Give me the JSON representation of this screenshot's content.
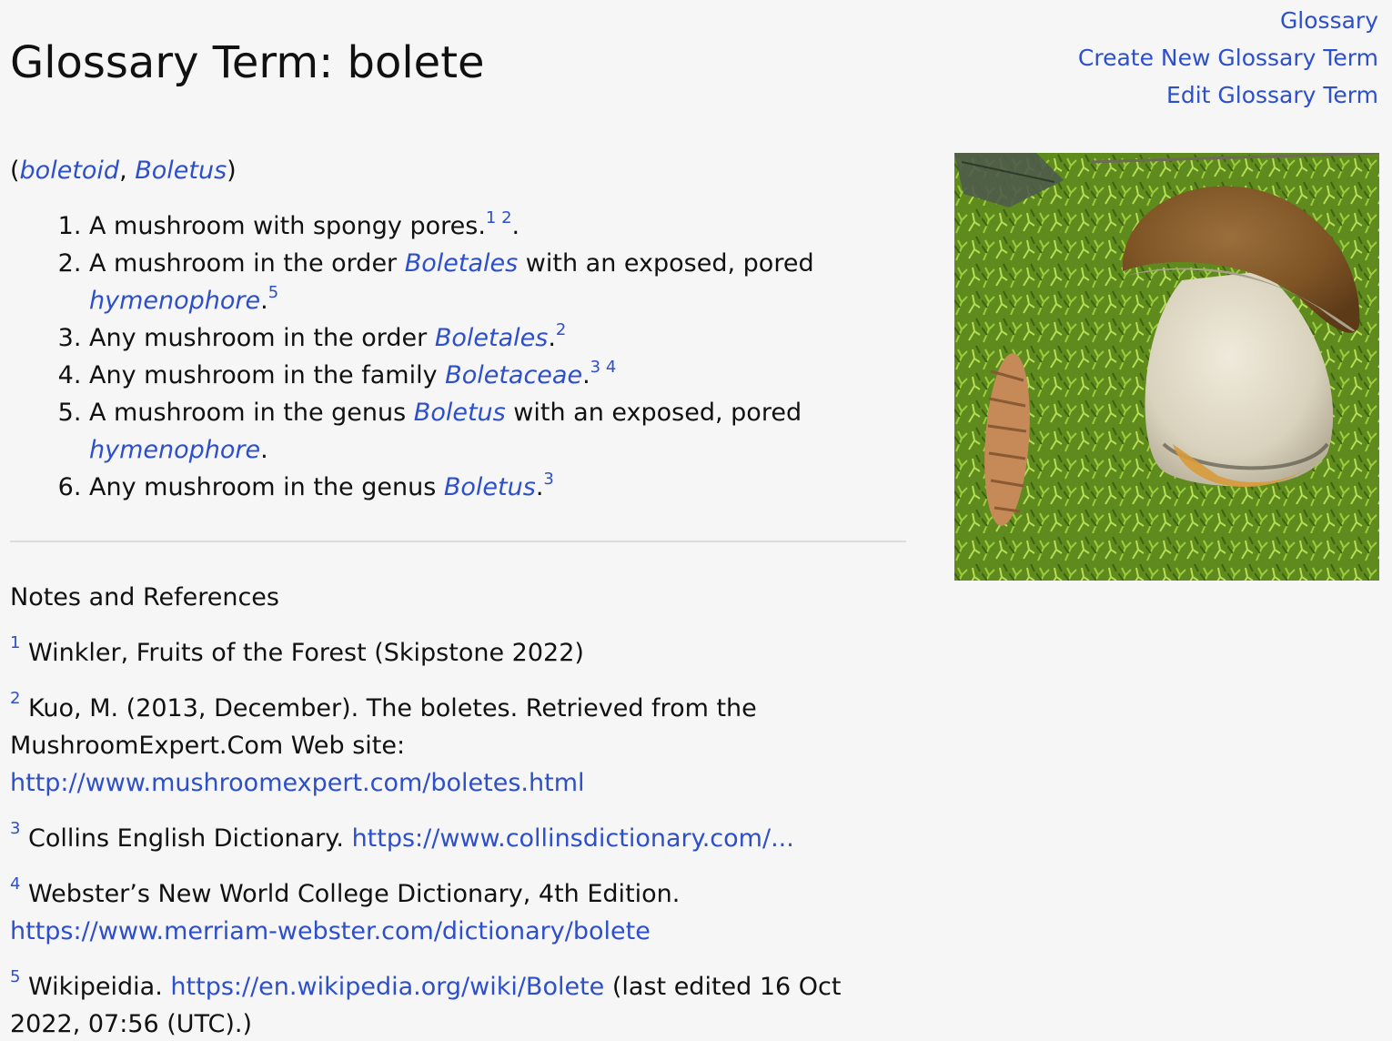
{
  "page": {
    "title": "Glossary Term: bolete"
  },
  "nav": {
    "glossary": "Glossary",
    "create": "Create New Glossary Term",
    "edit": "Edit Glossary Term"
  },
  "synonyms": {
    "open": "(",
    "sep": ", ",
    "close": ")",
    "items": [
      "boletoid",
      "Boletus"
    ]
  },
  "definitions": [
    {
      "pre": "A mushroom with spongy pores.",
      "refs": [
        "1",
        "2"
      ],
      "post": "."
    },
    {
      "pre": "A mushroom in the order ",
      "link1": "Boletales",
      "mid": " with an exposed, pored ",
      "link2": "hymenophore",
      "post": ".",
      "refs": [
        "5"
      ]
    },
    {
      "pre": "Any mushroom in the order ",
      "link1": "Boletales",
      "post": ".",
      "refs": [
        "2"
      ]
    },
    {
      "pre": "Any mushroom in the family ",
      "link1": "Boletaceae",
      "post": ".",
      "refs": [
        "3",
        "4"
      ]
    },
    {
      "pre": "A mushroom in the genus ",
      "link1": "Boletus",
      "mid": " with an exposed, pored ",
      "link2": "hymenophore",
      "post": "."
    },
    {
      "pre": "Any mushroom in the genus ",
      "link1": "Boletus",
      "post": ".",
      "refs": [
        "3"
      ]
    }
  ],
  "notes": {
    "heading": "Notes and References",
    "refs": [
      {
        "num": "1",
        "text": "Winkler, Fruits of the Forest (Skipstone 2022)"
      },
      {
        "num": "2",
        "text": "Kuo, M. (2013, December). The boletes. Retrieved from the MushroomExpert.Com Web site: ",
        "link": "http://www.mushroomexpert.com/boletes.html"
      },
      {
        "num": "3",
        "text": "Collins English Dictionary. ",
        "link": "https://www.collinsdictionary.com/..."
      },
      {
        "num": "4",
        "text": "Webster’s New World College Dictionary, 4th Edition. ",
        "link": "https://www.merriam-webster.com/dictionary/bolete"
      },
      {
        "num": "5",
        "text": "Wikipeidia. ",
        "link": "https://en.wikipedia.org/wiki/Bolete",
        "after": " (last edited 16 Oct 2022, 07:56 (UTC).)"
      }
    ]
  },
  "colors": {
    "link": "#2d4fc9",
    "background": "#f6f6f6"
  }
}
